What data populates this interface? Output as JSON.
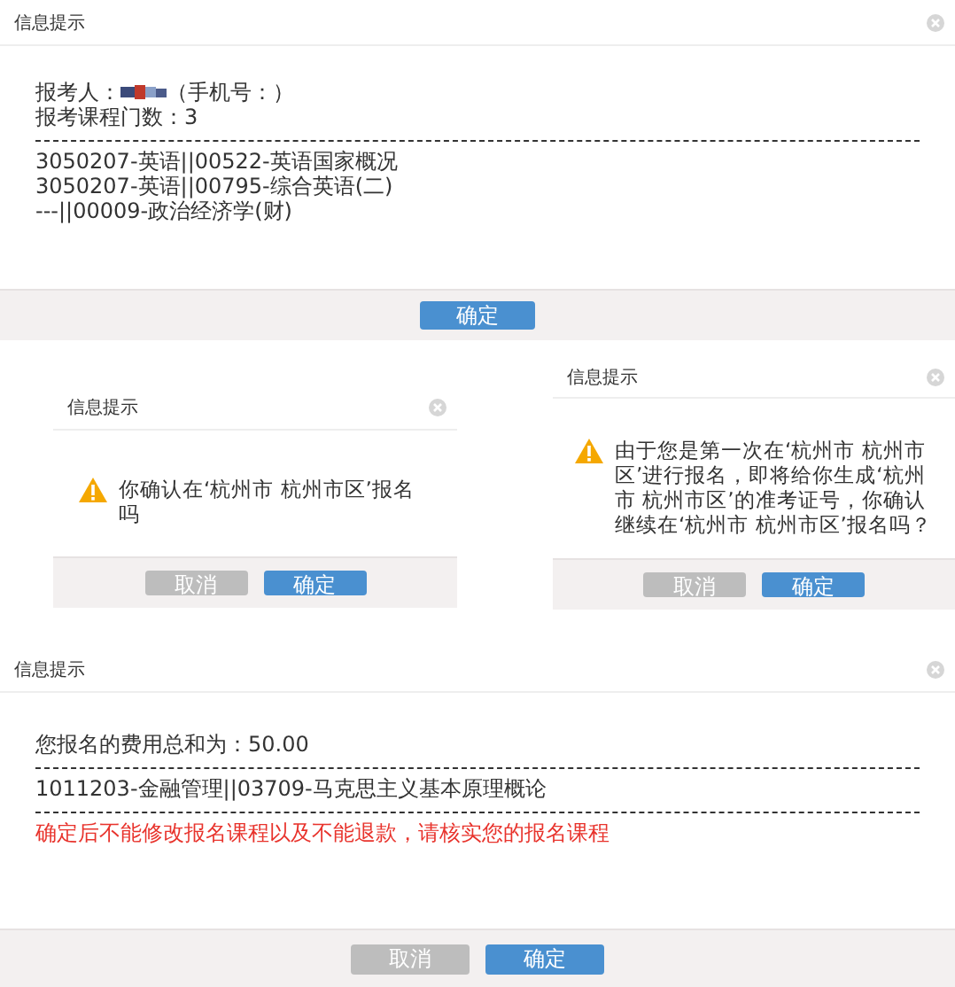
{
  "dialogs": [
    {
      "kind": "course_list",
      "title": "信息提示",
      "applicant_label": "报考人：",
      "phone_label": "（手机号：）",
      "count_line": "报考课程门数：3",
      "courses": [
        "3050207-英语||00522-英语国家概况",
        "3050207-英语||00795-综合英语(二)",
        "---||00009-政治经济学(财)"
      ],
      "buttons": [
        {
          "label": "确定",
          "kind": "primary"
        }
      ]
    },
    {
      "kind": "confirm",
      "title": "信息提示",
      "message": "你确认在‘杭州市 杭州市区’报名吗",
      "buttons": [
        {
          "label": "取消",
          "kind": "secondary"
        },
        {
          "label": "确定",
          "kind": "primary"
        }
      ]
    },
    {
      "kind": "confirm",
      "title": "信息提示",
      "message": "由于您是第一次在‘杭州市 杭州市区’进行报名，即将给你生成‘杭州市 杭州市区’的准考证号，你确认继续在‘杭州市 杭州市区’报名吗？",
      "buttons": [
        {
          "label": "取消",
          "kind": "secondary"
        },
        {
          "label": "确定",
          "kind": "primary"
        }
      ]
    },
    {
      "kind": "fee",
      "title": "信息提示",
      "fee_line": "您报名的费用总和为：50.00",
      "courses": [
        "1011203-金融管理||03709-马克思主义基本原理概论"
      ],
      "warning": "确定后不能修改报名课程以及不能退款，请核实您的报名课程",
      "buttons": [
        {
          "label": "取消",
          "kind": "secondary"
        },
        {
          "label": "确定",
          "kind": "primary"
        }
      ]
    }
  ]
}
